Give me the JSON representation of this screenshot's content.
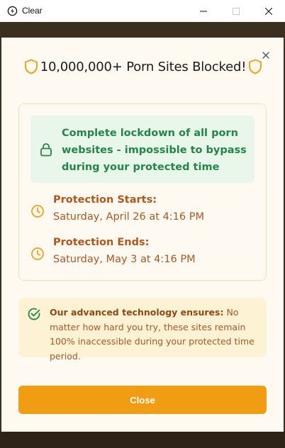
{
  "window": {
    "title": "Clear",
    "minimize_icon": "minimize-icon",
    "maximize_icon": "maximize-icon",
    "close_icon": "close-icon"
  },
  "modal": {
    "heading": "10,000,000+ Porn Sites Blocked!",
    "heading_icon": "shield-icon",
    "dismiss_icon": "close-icon",
    "lockdown": {
      "icon": "lock-icon",
      "text": "Complete lockdown of all porn websites - impossible to bypass during your protected time"
    },
    "protection_starts": {
      "icon": "clock-icon",
      "label": "Protection Starts:",
      "value": "Saturday, April 26 at 4:16 PM"
    },
    "protection_ends": {
      "icon": "clock-icon",
      "label": "Protection Ends:",
      "value": "Saturday, May 3 at 4:16 PM"
    },
    "note": {
      "icon": "check-circle-icon",
      "strong": "Our advanced technology ensures:",
      "text": " No matter how hard you try, these sites remain 100% inaccessible during your protected time period."
    },
    "close_button": "Close"
  },
  "colors": {
    "accent": "#f19d14",
    "success_green": "#23854a",
    "warning_brown": "#b0561b",
    "modal_bg": "#fffaf1",
    "lock_box_bg": "#e9f6ea",
    "note_bg": "#fdf2d3"
  }
}
